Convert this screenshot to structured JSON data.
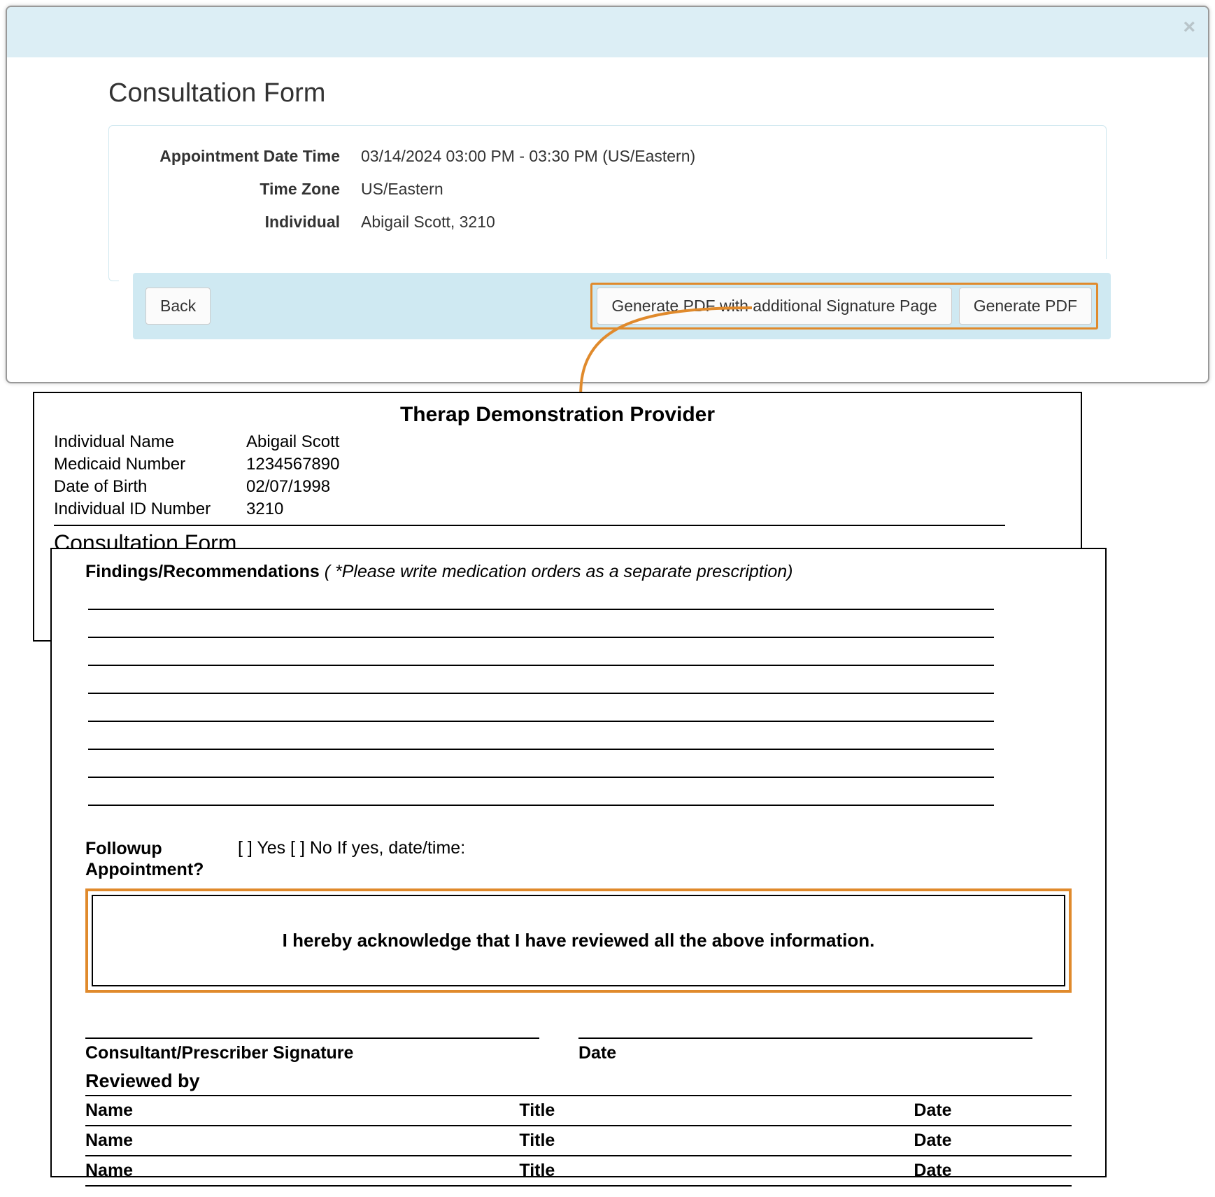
{
  "modal": {
    "title": "Consultation Form",
    "close_glyph": "×",
    "fields": {
      "appt_label": "Appointment Date Time",
      "appt_value": "03/14/2024 03:00 PM - 03:30 PM (US/Eastern)",
      "tz_label": "Time Zone",
      "tz_value": "US/Eastern",
      "ind_label": "Individual",
      "ind_value": "Abigail Scott, 3210"
    },
    "actions": {
      "back": "Back",
      "gen_sig": "Generate PDF with additional Signature Page",
      "gen_pdf": "Generate PDF"
    }
  },
  "pdf": {
    "provider": "Therap Demonstration Provider",
    "meta": {
      "name_label": "Individual Name",
      "name_value": "Abigail Scott",
      "medicaid_label": "Medicaid Number",
      "medicaid_value": "1234567890",
      "dob_label": "Date of Birth",
      "dob_value": "02/07/1998",
      "idnum_label": "Individual ID Number",
      "idnum_value": "3210"
    },
    "form_title": "Consultation Form",
    "findings_label": "Findings/Recommendations",
    "findings_note": "( *Please write medication orders as a separate prescription)",
    "followup_label": "Followup Appointment?",
    "followup_opts": "[  ] Yes   [  ] No   If yes, date/time:",
    "ack_text": "I hereby acknowledge that I have reviewed all the above information.",
    "sig_label": "Consultant/Prescriber Signature",
    "date_label": "Date",
    "reviewed_title": "Reviewed by",
    "rev_cols": {
      "name": "Name",
      "title": "Title",
      "date": "Date"
    }
  }
}
